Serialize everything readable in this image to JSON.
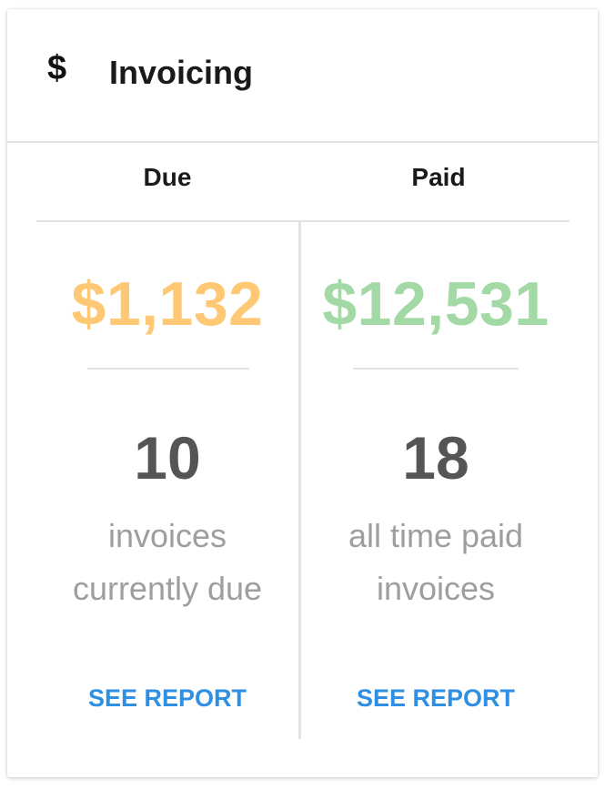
{
  "card": {
    "icon": "$",
    "icon_name": "dollar-icon",
    "title": "Invoicing"
  },
  "columns": [
    {
      "heading": "Due",
      "amount": "$1,132",
      "amount_color": "#ffc875",
      "count": "10",
      "description_lines": [
        "invoices",
        "currently due"
      ],
      "link": "SEE REPORT"
    },
    {
      "heading": "Paid",
      "amount": "$12,531",
      "amount_color": "#a3d9a5",
      "count": "18",
      "description_lines": [
        "all time paid",
        "invoices"
      ],
      "link": "SEE REPORT"
    }
  ],
  "colors": {
    "link": "#2f8fe3",
    "count": "#555555",
    "description": "#9e9e9e",
    "divider": "#e3e3e3"
  }
}
